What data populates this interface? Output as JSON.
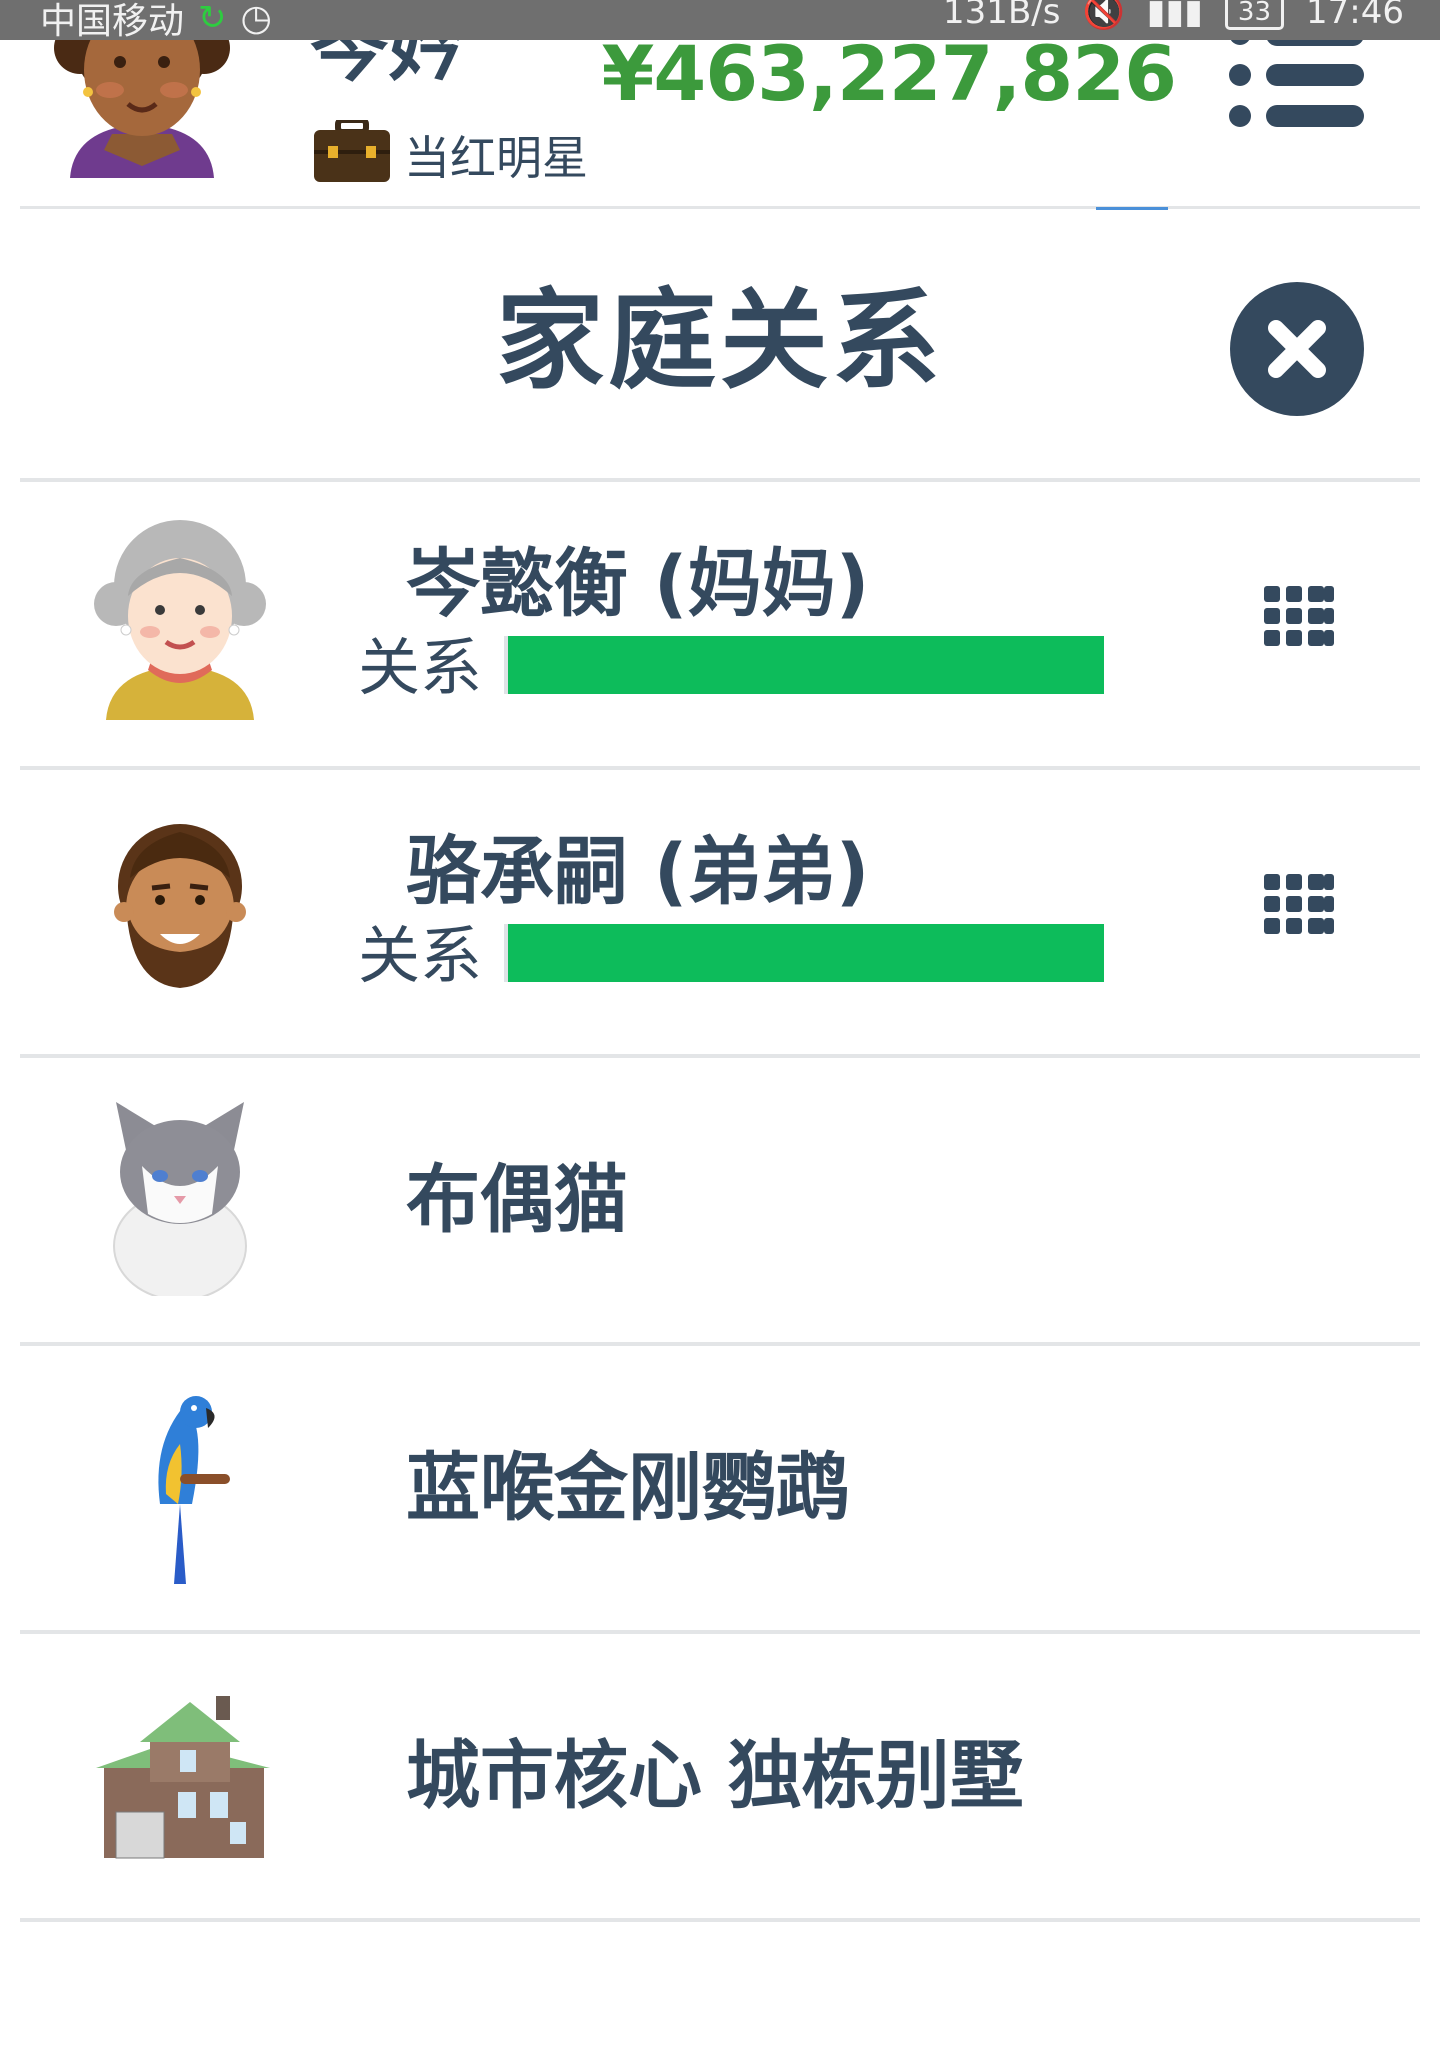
{
  "status_bar": {
    "carrier": "中国移动",
    "speed": "131B/s",
    "battery": "33",
    "time": "17:46"
  },
  "player": {
    "name": "岑妗",
    "job": "当红明星",
    "money": "¥463,227,826"
  },
  "modal": {
    "title": "家庭关系"
  },
  "relation_label": "关系",
  "family": [
    {
      "name": "岑懿衡 (妈妈)",
      "relationship": 1.0,
      "avatar": "grandma-avatar"
    },
    {
      "name": "骆承嗣 (弟弟)",
      "relationship": 1.0,
      "avatar": "bearded-man-avatar"
    }
  ],
  "pets": [
    {
      "name": "布偶猫",
      "avatar": "ragdoll-cat-icon"
    },
    {
      "name": "蓝喉金刚鹦鹉",
      "avatar": "blue-macaw-icon"
    }
  ],
  "property": [
    {
      "name": "城市核心 独栋别墅",
      "avatar": "villa-house-icon"
    }
  ],
  "colors": {
    "text": "#34495e",
    "money": "#3c9a3c",
    "relation_bar": "#0dbc5b",
    "divider": "#e3e5e7"
  }
}
